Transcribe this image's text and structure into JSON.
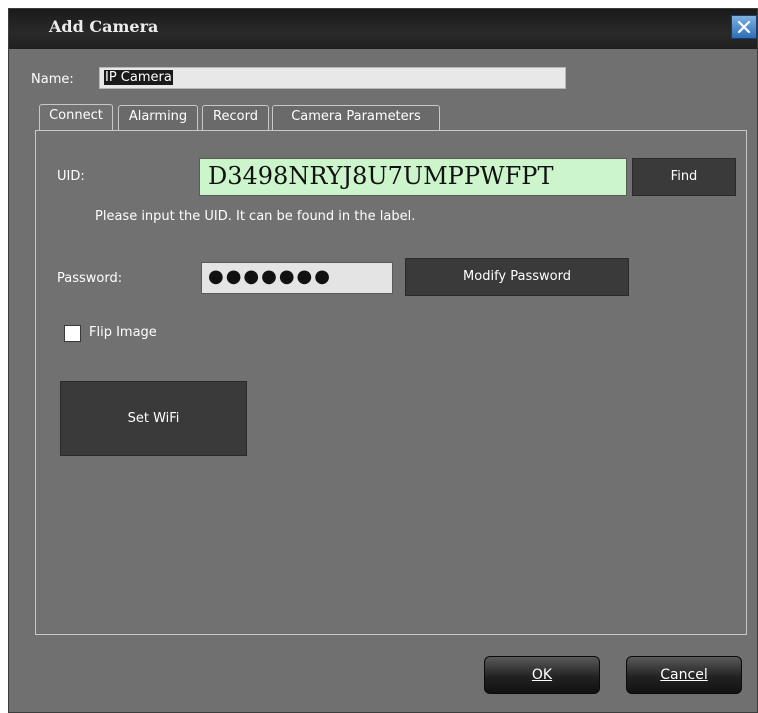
{
  "window": {
    "title": "Add Camera"
  },
  "name_field": {
    "label": "Name:",
    "value": "IP Camera"
  },
  "tabs": [
    {
      "label": "Connect",
      "active": true
    },
    {
      "label": "Alarming",
      "active": false
    },
    {
      "label": "Record",
      "active": false
    },
    {
      "label": "Camera Parameters",
      "active": false
    }
  ],
  "connect": {
    "uid_label": "UID:",
    "uid_value": "D3498NRYJ8U7UMPPWFPT",
    "find_label": "Find",
    "uid_hint": "Please input the UID. It can be found in the label.",
    "password_label": "Password:",
    "password_value": "●●●●●●●",
    "modify_password_label": "Modify Password",
    "flip_label": "Flip Image",
    "flip_checked": false,
    "set_wifi_label": "Set WiFi"
  },
  "footer": {
    "ok_label": "OK",
    "cancel_label": "Cancel"
  },
  "colors": {
    "uid_background": "#ccf5cc",
    "dialog_background": "#707070",
    "titlebar": "#1f1f1f",
    "close_button": "#2d6fb8"
  },
  "icons": {
    "close": "close-icon"
  }
}
